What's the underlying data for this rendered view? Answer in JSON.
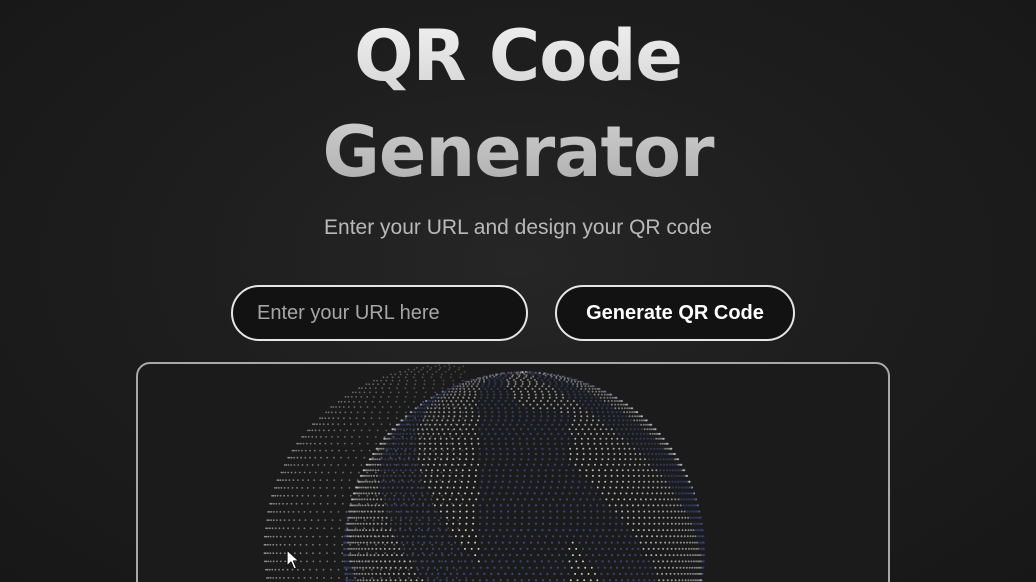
{
  "header": {
    "title_line1": "QR Code",
    "title_line2": "Generator",
    "subtitle": "Enter your URL and design your QR code"
  },
  "form": {
    "url_input": {
      "value": "",
      "placeholder": "Enter your URL here"
    },
    "generate_label": "Generate QR Code"
  },
  "preview": {
    "visual": "particle-sphere",
    "colors": {
      "dot_light": "#d9d9d9",
      "dot_blue": "#3b4c86",
      "frame_border": "#a8a8a8"
    }
  },
  "colors": {
    "background": "#1e1e1e",
    "button_border": "#e6e6e6",
    "subtitle": "#b9b9b9"
  }
}
